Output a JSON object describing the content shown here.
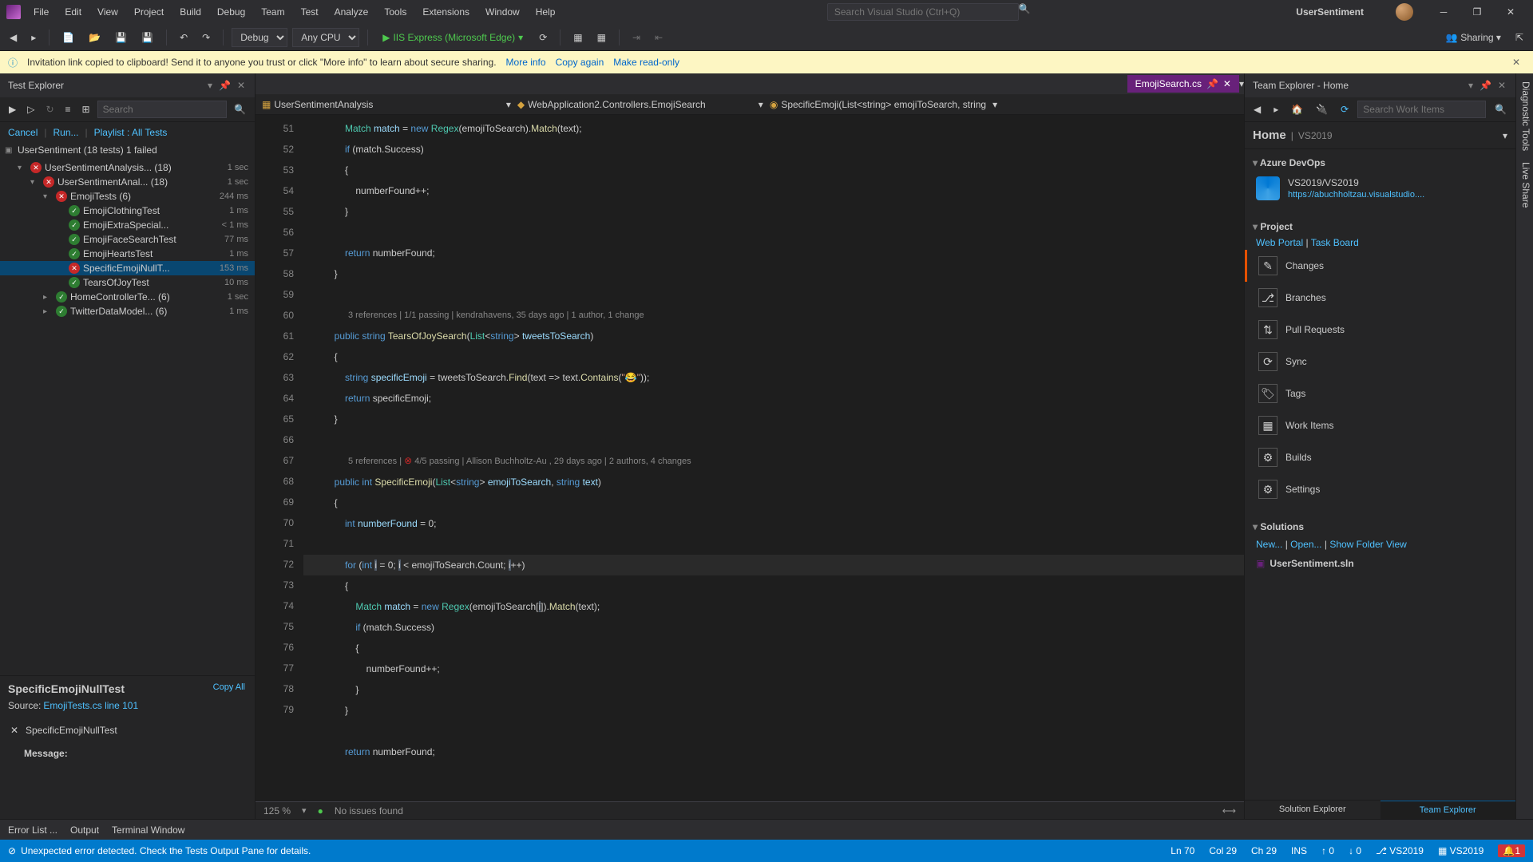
{
  "menu": {
    "items": [
      "File",
      "Edit",
      "View",
      "Project",
      "Build",
      "Debug",
      "Team",
      "Test",
      "Analyze",
      "Tools",
      "Extensions",
      "Window",
      "Help"
    ]
  },
  "search_placeholder": "Search Visual Studio (Ctrl+Q)",
  "app_title": "UserSentiment",
  "toolbar": {
    "config": "Debug",
    "platform": "Any CPU",
    "run_label": "IIS Express (Microsoft Edge)",
    "sharing": "Sharing"
  },
  "infobar": {
    "text": "Invitation link copied to clipboard! Send it to anyone you trust or click \"More info\" to learn about secure sharing.",
    "more": "More info",
    "copy": "Copy again",
    "readonly": "Make read-only"
  },
  "testexplorer": {
    "title": "Test Explorer",
    "search_placeholder": "Search",
    "links": {
      "cancel": "Cancel",
      "run": "Run...",
      "playlist": "Playlist : All Tests"
    },
    "root": {
      "name": "UserSentiment (18 tests) 1 failed"
    },
    "nodes": [
      {
        "depth": 1,
        "chev": "▾",
        "status": "fail",
        "name": "UserSentimentAnalysis... (18)",
        "time": "1 sec"
      },
      {
        "depth": 2,
        "chev": "▾",
        "status": "fail",
        "name": "UserSentimentAnal... (18)",
        "time": "1 sec"
      },
      {
        "depth": 3,
        "chev": "▾",
        "status": "fail",
        "name": "EmojiTests (6)",
        "time": "244 ms"
      },
      {
        "depth": 4,
        "chev": "",
        "status": "pass",
        "name": "EmojiClothingTest",
        "time": "1 ms"
      },
      {
        "depth": 4,
        "chev": "",
        "status": "pass",
        "name": "EmojiExtraSpecial...",
        "time": "< 1 ms"
      },
      {
        "depth": 4,
        "chev": "",
        "status": "pass",
        "name": "EmojiFaceSearchTest",
        "time": "77 ms"
      },
      {
        "depth": 4,
        "chev": "",
        "status": "pass",
        "name": "EmojiHeartsTest",
        "time": "1 ms"
      },
      {
        "depth": 4,
        "chev": "",
        "status": "fail",
        "name": "SpecificEmojiNullT...",
        "time": "153 ms",
        "sel": true
      },
      {
        "depth": 4,
        "chev": "",
        "status": "pass",
        "name": "TearsOfJoyTest",
        "time": "10 ms"
      },
      {
        "depth": 3,
        "chev": "▸",
        "status": "pass",
        "name": "HomeControllerTe... (6)",
        "time": "1 sec"
      },
      {
        "depth": 3,
        "chev": "▸",
        "status": "pass",
        "name": "TwitterDataModel... (6)",
        "time": "1 ms"
      }
    ],
    "detail": {
      "title": "SpecificEmojiNullTest",
      "copy": "Copy All",
      "source_lbl": "Source:",
      "source": "EmojiTests.cs line 101",
      "fail": "SpecificEmojiNullTest",
      "msg": "Message:"
    }
  },
  "editor": {
    "tab": "EmojiSearch.cs",
    "crumbs": [
      "UserSentimentAnalysis",
      "WebApplication2.Controllers.EmojiSearch",
      "SpecificEmoji(List<string> emojiToSearch, string"
    ],
    "codelens1": "3 references | 1/1 passing | kendrahavens, 35 days ago | 1 author, 1 change",
    "codelens2": "5 references |  4/5 passing | Allison Buchholtz-Au    , 29 days ago | 2 authors, 4 changes",
    "lines_start": 51,
    "lines_end": 79,
    "status": {
      "zoom": "125 %",
      "issues": "No issues found"
    }
  },
  "teamexplorer": {
    "title": "Team Explorer - Home",
    "search_placeholder": "Search Work Items",
    "home": "Home",
    "home_sub": "VS2019",
    "azure": {
      "h": "Azure DevOps",
      "name": "VS2019/VS2019",
      "url": "https://abuchholtzau.visualstudio...."
    },
    "project": {
      "h": "Project",
      "portal": "Web Portal",
      "board": "Task Board",
      "tiles": [
        "Changes",
        "Branches",
        "Pull Requests",
        "Sync",
        "Tags",
        "Work Items",
        "Builds",
        "Settings"
      ]
    },
    "solutions": {
      "h": "Solutions",
      "new": "New...",
      "open": "Open...",
      "folder": "Show Folder View",
      "file": "UserSentiment.sln"
    },
    "tabs": {
      "sol": "Solution Explorer",
      "team": "Team Explorer"
    }
  },
  "output_tabs": [
    "Error List ...",
    "Output",
    "Terminal Window"
  ],
  "statusbar": {
    "err": "Unexpected error detected. Check the Tests Output Pane for details.",
    "ln": "Ln 70",
    "col": "Col 29",
    "ch": "Ch 29",
    "ins": "INS",
    "up": "0",
    "down": "0",
    "repo1": "VS2019",
    "repo2": "VS2019",
    "bell": "1"
  },
  "vtabs": [
    "Diagnostic Tools",
    "Live Share"
  ]
}
